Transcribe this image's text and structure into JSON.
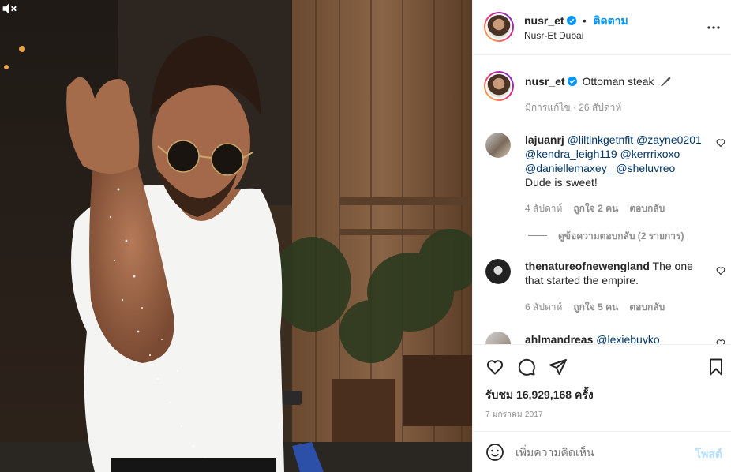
{
  "post": {
    "username": "nusr_et",
    "separator": "•",
    "follow_label": "ติดตาม",
    "location": "Nusr-Et Dubai"
  },
  "caption": {
    "username": "nusr_et",
    "text": "Ottoman steak",
    "meta": "มีการแก้ไข · 26 สัปดาห์"
  },
  "comments": [
    {
      "username": "lajuanrj",
      "mentions": [
        "@liltinkgetnfit",
        "@zayne0201",
        "@kendra_leigh119",
        "@kerrrixoxo",
        "@daniellemaxey_",
        "@sheluvreo"
      ],
      "text": "Dude is sweet!",
      "time": "4 สัปดาห์",
      "likes": "ถูกใจ 2 คน",
      "reply": "ตอบกลับ",
      "view_replies": "ดูข้อความตอบกลับ (2 รายการ)"
    },
    {
      "username": "thenatureofnewengland",
      "text": "The one that started the empire.",
      "time": "6 สัปดาห์",
      "likes": "ถูกใจ 5 คน",
      "reply": "ตอบกลับ"
    },
    {
      "username": "ahlmandreas",
      "text": "@lexiebuyko"
    }
  ],
  "views": "รับชม 16,929,168 ครั้ง",
  "date": "7 มกราคม 2017",
  "add_comment": {
    "placeholder": "เพิ่มความคิดเห็น",
    "post_label": "โพสต์"
  },
  "icons": {
    "more": "more-horizontal-icon",
    "like": "heart-icon",
    "comment": "comment-icon",
    "share": "share-icon",
    "save": "bookmark-icon",
    "emoji": "emoji-icon",
    "mute": "muted-speaker-icon",
    "verified": "verified-badge-icon"
  },
  "colors": {
    "accent": "#0095f6",
    "verified": "#0095f6",
    "text": "#262626",
    "secondary": "#8e8e8e",
    "mention": "#00376b",
    "post_disabled": "#b2dffc"
  }
}
